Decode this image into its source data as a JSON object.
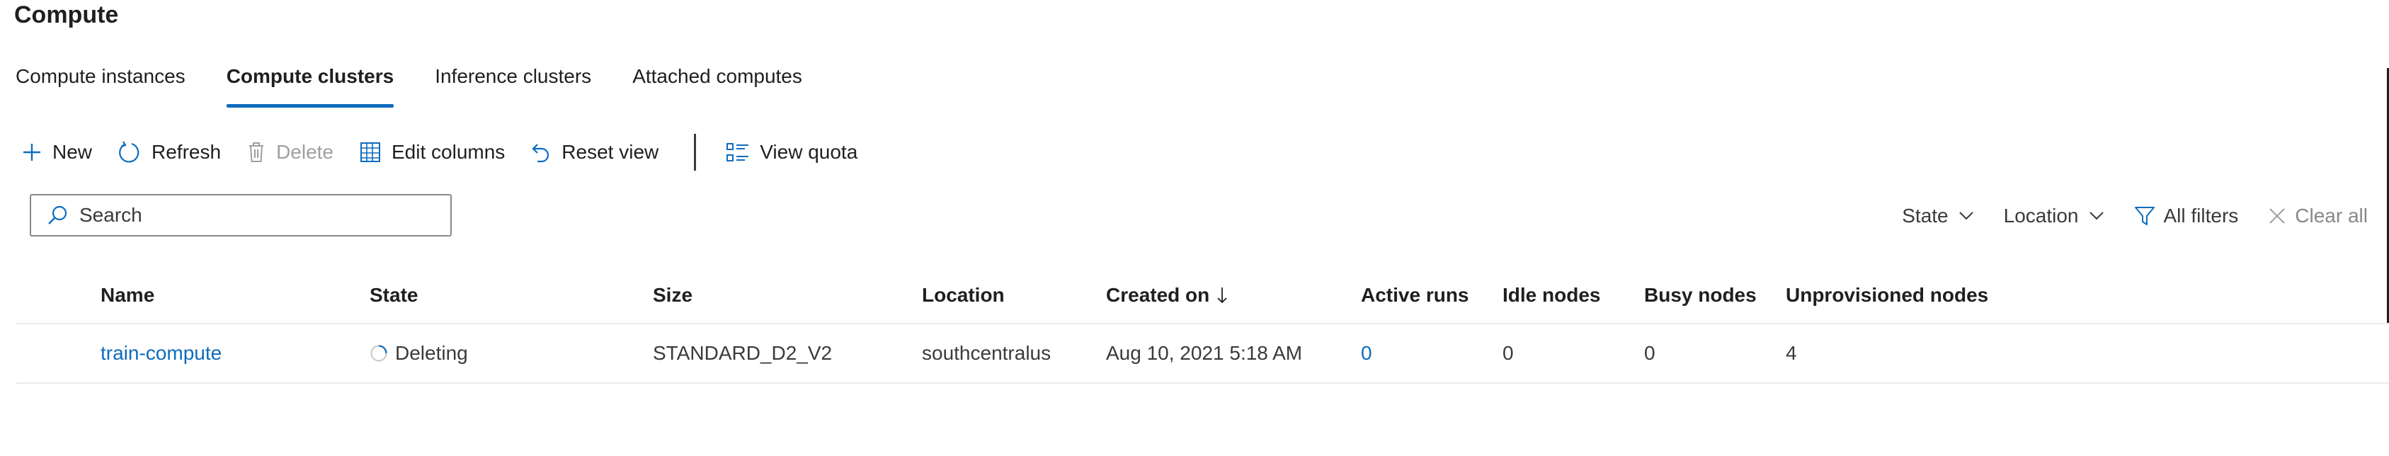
{
  "page": {
    "title": "Compute"
  },
  "tabs": [
    {
      "label": "Compute instances",
      "active": false
    },
    {
      "label": "Compute clusters",
      "active": true
    },
    {
      "label": "Inference clusters",
      "active": false
    },
    {
      "label": "Attached computes",
      "active": false
    }
  ],
  "toolbar": {
    "new_label": "New",
    "refresh_label": "Refresh",
    "delete_label": "Delete",
    "edit_columns_label": "Edit columns",
    "reset_view_label": "Reset view",
    "view_quota_label": "View quota"
  },
  "search": {
    "placeholder": "Search",
    "value": ""
  },
  "filters": {
    "state_label": "State",
    "location_label": "Location",
    "all_filters_label": "All filters",
    "clear_all_label": "Clear all"
  },
  "table": {
    "columns": {
      "name": "Name",
      "state": "State",
      "size": "Size",
      "location": "Location",
      "created_on": "Created on",
      "active_runs": "Active runs",
      "idle_nodes": "Idle nodes",
      "busy_nodes": "Busy nodes",
      "unprovisioned_nodes": "Unprovisioned nodes"
    },
    "rows": [
      {
        "name": "train-compute",
        "state": "Deleting",
        "size": "STANDARD_D2_V2",
        "location": "southcentralus",
        "created_on": "Aug 10, 2021 5:18 AM",
        "active_runs": "0",
        "idle_nodes": "0",
        "busy_nodes": "0",
        "unprovisioned_nodes": "4"
      }
    ]
  },
  "colors": {
    "accent": "#0f6cbd",
    "text": "#201f1e",
    "muted": "#3b3a39",
    "disabled": "#a19f9d",
    "divider": "#edebe9"
  },
  "icons": {
    "new": "plus-icon",
    "refresh": "refresh-icon",
    "delete": "trash-icon",
    "edit_columns": "table-grid-icon",
    "reset_view": "reset-icon",
    "view_quota": "list-icon",
    "search": "search-icon",
    "filter": "filter-funnel-icon",
    "clear": "close-icon",
    "sort": "sort-down-arrow-icon",
    "state_pending": "spinner-icon"
  }
}
